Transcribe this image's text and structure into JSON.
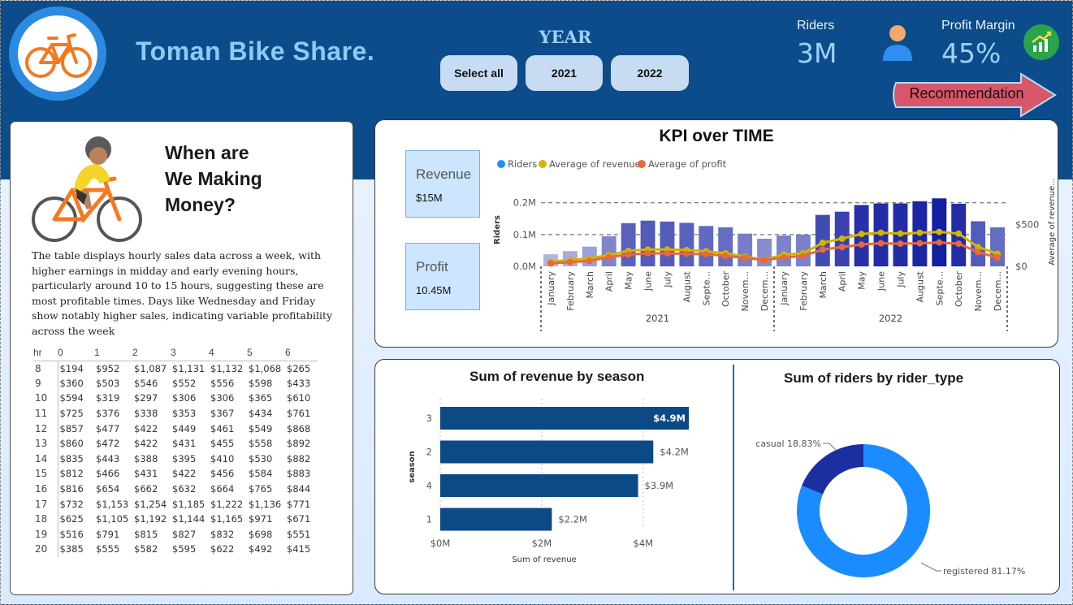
{
  "header": {
    "brand": "Toman Bike Share.",
    "year_label": "YEAR",
    "year_buttons": [
      "Select all",
      "2021",
      "2022"
    ],
    "riders_label": "Riders",
    "riders_value": "3M",
    "profit_margin_label": "Profit Margin",
    "profit_margin_value": "45%",
    "recommendation_label": "Recommendation"
  },
  "left_panel": {
    "title": "When are\nWe Making\nMoney?",
    "description": "The table displays hourly sales data across a week, with higher earnings in midday and early evening hours, particularly around 10 to 15 hours, suggesting these are most profitable times. Days like Wednesday and Friday show notably higher sales, indicating variable profitability across the week",
    "table": {
      "corner": "hr",
      "columns": [
        "0",
        "1",
        "2",
        "3",
        "4",
        "5",
        "6"
      ],
      "rows": [
        {
          "hr": "8",
          "cells": [
            "$194",
            "$952",
            "$1,087",
            "$1,131",
            "$1,132",
            "$1,068",
            "$265"
          ]
        },
        {
          "hr": "9",
          "cells": [
            "$360",
            "$503",
            "$546",
            "$552",
            "$556",
            "$598",
            "$433"
          ]
        },
        {
          "hr": "10",
          "cells": [
            "$594",
            "$319",
            "$297",
            "$306",
            "$306",
            "$365",
            "$610"
          ]
        },
        {
          "hr": "11",
          "cells": [
            "$725",
            "$376",
            "$338",
            "$353",
            "$367",
            "$434",
            "$761"
          ]
        },
        {
          "hr": "12",
          "cells": [
            "$857",
            "$477",
            "$422",
            "$449",
            "$461",
            "$549",
            "$868"
          ]
        },
        {
          "hr": "13",
          "cells": [
            "$860",
            "$472",
            "$422",
            "$431",
            "$455",
            "$558",
            "$892"
          ]
        },
        {
          "hr": "14",
          "cells": [
            "$835",
            "$443",
            "$388",
            "$395",
            "$410",
            "$530",
            "$882"
          ]
        },
        {
          "hr": "15",
          "cells": [
            "$812",
            "$466",
            "$431",
            "$422",
            "$456",
            "$584",
            "$883"
          ]
        },
        {
          "hr": "16",
          "cells": [
            "$816",
            "$654",
            "$662",
            "$632",
            "$664",
            "$765",
            "$844"
          ]
        },
        {
          "hr": "17",
          "cells": [
            "$732",
            "$1,153",
            "$1,254",
            "$1,185",
            "$1,222",
            "$1,136",
            "$771"
          ]
        },
        {
          "hr": "18",
          "cells": [
            "$625",
            "$1,105",
            "$1,192",
            "$1,144",
            "$1,165",
            "$971",
            "$671"
          ]
        },
        {
          "hr": "19",
          "cells": [
            "$516",
            "$791",
            "$815",
            "$827",
            "$832",
            "$698",
            "$551"
          ]
        },
        {
          "hr": "20",
          "cells": [
            "$385",
            "$555",
            "$582",
            "$595",
            "$622",
            "$492",
            "$415"
          ]
        }
      ]
    }
  },
  "kpi_boxes": {
    "revenue_label": "Revenue",
    "revenue_value": "$15M",
    "profit_label": "Profit",
    "profit_value": "10.45M"
  },
  "colors": {
    "header_bg": "#0d4c8a",
    "riders": "#1e90ff",
    "avg_revenue": "#d4b400",
    "avg_profit": "#e8693a",
    "bar_navy": "#0b4a85",
    "donut_registered": "#1a8cff",
    "donut_casual": "#1b2fa0"
  },
  "chart_data": [
    {
      "type": "bar",
      "title": "KPI over TIME",
      "legend": [
        "Riders",
        "Average of revenue",
        "Average of profit"
      ],
      "ylabel": "Riders",
      "ylabel_right": "Average of revenue...",
      "ylim": [
        0,
        230000
      ],
      "ylim_right": [
        0,
        870
      ],
      "y_ticks": [
        "0.0M",
        "0.1M",
        "0.2M"
      ],
      "y_ticks_right": [
        "$0",
        "$500"
      ],
      "groups": [
        "2021",
        "2022"
      ],
      "categories": [
        "January",
        "February",
        "March",
        "April",
        "May",
        "June",
        "July",
        "August",
        "Septe...",
        "October",
        "Novem...",
        "Decem...",
        "January",
        "February",
        "March",
        "April",
        "May",
        "June",
        "July",
        "August",
        "Septe...",
        "October",
        "Novem...",
        "Decem..."
      ],
      "series": [
        {
          "name": "Riders",
          "kind": "bar",
          "values": [
            38000,
            48000,
            62000,
            95000,
            136000,
            144000,
            141000,
            137000,
            127000,
            123000,
            103000,
            87000,
            97000,
            100000,
            162000,
            172000,
            193000,
            198000,
            198000,
            205000,
            214000,
            197000,
            142000,
            123000
          ]
        },
        {
          "name": "Average of revenue",
          "kind": "line",
          "values": [
            55,
            75,
            95,
            135,
            185,
            200,
            200,
            195,
            180,
            155,
            115,
            80,
            140,
            155,
            280,
            330,
            385,
            400,
            390,
            400,
            410,
            390,
            230,
            150
          ]
        },
        {
          "name": "Average of profit",
          "kind": "line",
          "values": [
            35,
            50,
            65,
            110,
            140,
            155,
            155,
            150,
            145,
            125,
            100,
            75,
            105,
            125,
            200,
            230,
            260,
            275,
            270,
            275,
            285,
            270,
            170,
            105
          ]
        }
      ]
    },
    {
      "type": "bar",
      "orientation": "horizontal",
      "title": "Sum of revenue by season",
      "xlabel": "Sum of revenue",
      "ylabel": "season",
      "categories": [
        "3",
        "2",
        "4",
        "1"
      ],
      "values": [
        4.9,
        4.2,
        3.9,
        2.2
      ],
      "labels": [
        "$4.9M",
        "$4.2M",
        "$3.9M",
        "$2.2M"
      ],
      "x_ticks": [
        "$0M",
        "$2M",
        "$4M"
      ],
      "xlim": [
        0,
        4.9
      ]
    },
    {
      "type": "pie",
      "style": "donut",
      "title": "Sum of riders by rider_type",
      "slices": [
        {
          "name": "registered",
          "value": 81.17,
          "label": "registered 81.17%"
        },
        {
          "name": "casual",
          "value": 18.83,
          "label": "casual 18.83%"
        }
      ]
    }
  ]
}
